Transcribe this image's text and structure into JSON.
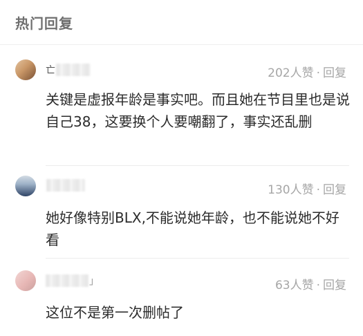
{
  "section": {
    "title": "热门回复"
  },
  "comments": [
    {
      "avatar": {
        "colors": [
          "#c99767",
          "#7a5134",
          "#e3c3a0"
        ]
      },
      "username_partial": "亡",
      "likes": "202人赞",
      "separator": "·",
      "reply_label": "回复",
      "text": "关键是虚报年龄是事实吧。而且她在节目里也是说自己38，这要换个人要嘲翻了，事实还乱删"
    },
    {
      "avatar": {
        "colors": [
          "#2f4466",
          "#9fb3c9",
          "#d3dbe3"
        ]
      },
      "username_partial": "",
      "likes": "130人赞",
      "separator": "·",
      "reply_label": "回复",
      "text": "她好像特别BLX,不能说她年龄，也不能说她不好看"
    },
    {
      "avatar": {
        "colors": [
          "#e7b7b5",
          "#f2d6d4",
          "#caa09e"
        ]
      },
      "username_partial": "」",
      "likes": "63人赞",
      "separator": "·",
      "reply_label": "回复",
      "text": "这位不是第一次删帖了"
    }
  ]
}
